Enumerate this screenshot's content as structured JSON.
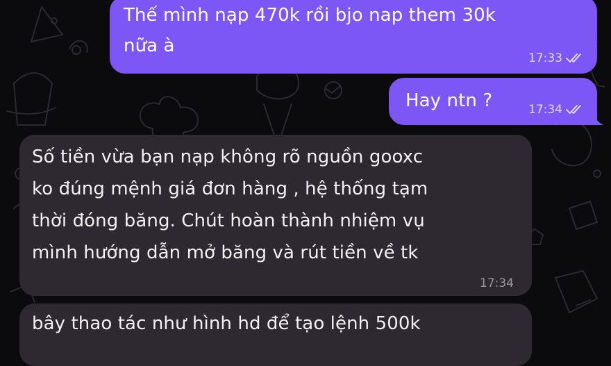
{
  "theme": {
    "outgoing_color": "#7c57f6",
    "incoming_color": "#2e2930",
    "background": "#0b0b0d"
  },
  "messages": [
    {
      "direction": "outgoing",
      "lines": [
        "Thế mình nạp 470k rồi bjo nap them 30k",
        "nữa à"
      ],
      "time": "17:33",
      "status_icon": "double-check-icon"
    },
    {
      "direction": "outgoing",
      "lines": [
        "Hay ntn ?"
      ],
      "time": "17:34",
      "status_icon": "double-check-icon"
    },
    {
      "direction": "incoming",
      "lines": [
        "Số tiền vừa bạn nạp không rõ nguồn gooxc",
        "ko đúng mệnh giá đơn hàng , hệ thống tạm",
        "thời đóng băng. Chút hoàn thành nhiệm vụ",
        "mình hướng dẫn mở băng và rút tiền về tk"
      ],
      "time": "17:34"
    },
    {
      "direction": "incoming",
      "lines": [
        "bây thao tác như hình hd để tạo lệnh 500k"
      ]
    }
  ]
}
